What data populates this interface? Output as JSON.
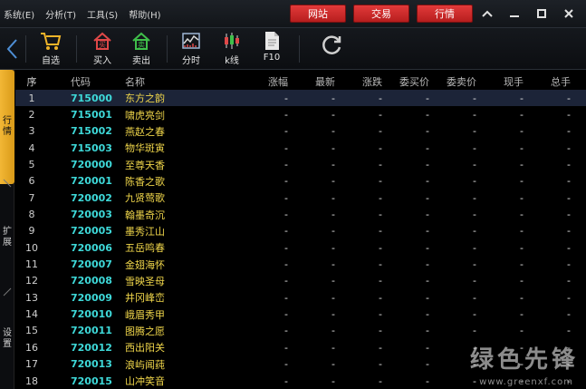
{
  "menu": [
    {
      "label": "系统",
      "key": "(E)"
    },
    {
      "label": "分析",
      "key": "(T)"
    },
    {
      "label": "工具",
      "key": "(S)"
    },
    {
      "label": "帮助",
      "key": "(H)"
    }
  ],
  "top_buttons": [
    "网站",
    "交易",
    "行情"
  ],
  "toolbar": {
    "zixuan": "自选",
    "buy": "买入",
    "sell": "卖出",
    "fenshi": "分时",
    "kline": "k线",
    "f10": "F10"
  },
  "sidebar": {
    "tab1": "行\n情",
    "tab2": "扩\n展",
    "tab3": "设\n置"
  },
  "table": {
    "headers": {
      "seq": "序",
      "code": "代码",
      "name": "名称",
      "change_pct": "涨幅",
      "last": "最新",
      "change": "涨跌",
      "bid": "委买价",
      "ask": "委卖价",
      "volume": "现手",
      "total": "总手"
    },
    "rows": [
      {
        "seq": "1",
        "code": "715000",
        "name": "东方之韵"
      },
      {
        "seq": "2",
        "code": "715001",
        "name": "啸虎亮剑"
      },
      {
        "seq": "3",
        "code": "715002",
        "name": "燕赵之春"
      },
      {
        "seq": "4",
        "code": "715003",
        "name": "物华斑寅"
      },
      {
        "seq": "5",
        "code": "720000",
        "name": "至尊天香"
      },
      {
        "seq": "6",
        "code": "720001",
        "name": "陈香之歌"
      },
      {
        "seq": "7",
        "code": "720002",
        "name": "九贤莺歌"
      },
      {
        "seq": "8",
        "code": "720003",
        "name": "翰墨奇沉"
      },
      {
        "seq": "9",
        "code": "720005",
        "name": "墨秀江山"
      },
      {
        "seq": "10",
        "code": "720006",
        "name": "五岳鸣春"
      },
      {
        "seq": "11",
        "code": "720007",
        "name": "金翅海怀"
      },
      {
        "seq": "12",
        "code": "720008",
        "name": "雪映圣母"
      },
      {
        "seq": "13",
        "code": "720009",
        "name": "井冈峰峦"
      },
      {
        "seq": "14",
        "code": "720010",
        "name": "峨眉秀甲"
      },
      {
        "seq": "15",
        "code": "720011",
        "name": "图腾之愿"
      },
      {
        "seq": "16",
        "code": "720012",
        "name": "西出阳关"
      },
      {
        "seq": "17",
        "code": "720013",
        "name": "浪屿闻莼"
      },
      {
        "seq": "18",
        "code": "720015",
        "name": "山冲笑音"
      }
    ],
    "empty_value": "-"
  },
  "watermark": {
    "text": "绿色先锋",
    "url": "www.greenxf.com"
  },
  "colors": {
    "accent_red": "#d42a2a",
    "code_cyan": "#3ed9d9",
    "name_yellow": "#f0d64a",
    "tab_gold": "#f2b736",
    "selected_row": "#1c2438"
  }
}
